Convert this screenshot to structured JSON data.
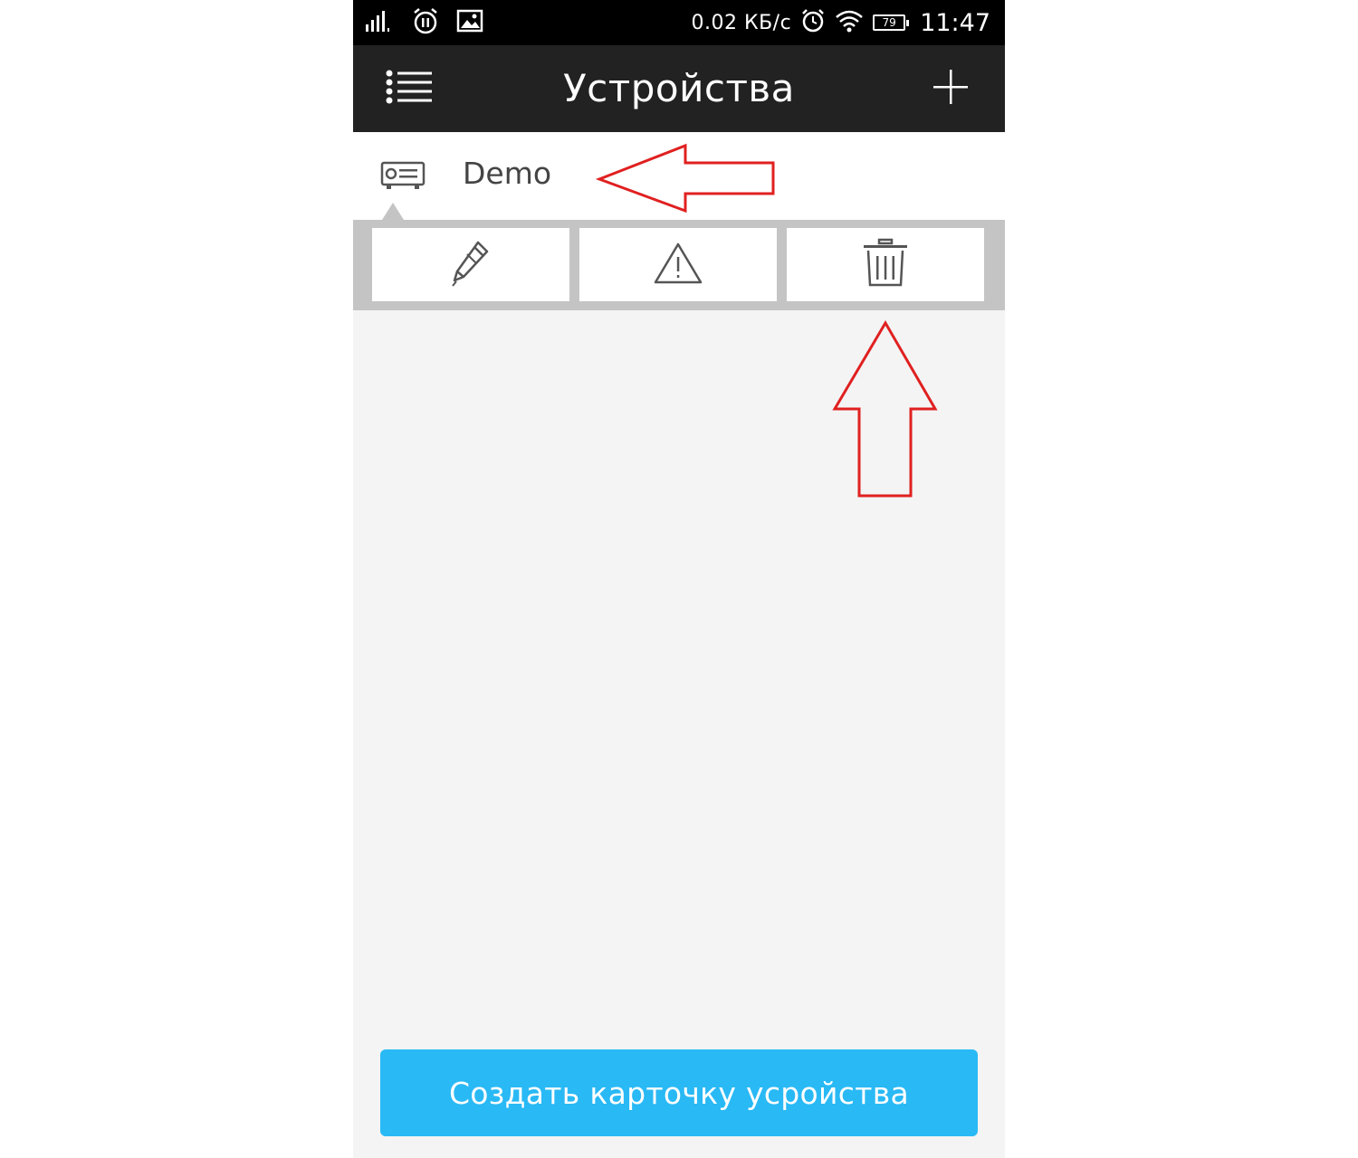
{
  "status_bar": {
    "speed": "0.02 КБ/с",
    "battery": "79",
    "time": "11:47"
  },
  "app_bar": {
    "title": "Устройства"
  },
  "device": {
    "name": "Demo"
  },
  "actions": {
    "icons": [
      "pencil-icon",
      "warning-icon",
      "trash-icon"
    ]
  },
  "create_button": {
    "label": "Создать карточку усройства"
  },
  "colors": {
    "status_bar_bg": "#000000",
    "app_bar_bg": "#222222",
    "content_bg": "#f4f4f4",
    "panel_bg": "#c4c4c4",
    "primary_button": "#29b9f5",
    "annotation_arrow": "#e02020"
  }
}
